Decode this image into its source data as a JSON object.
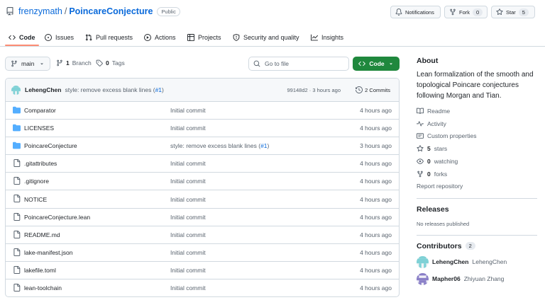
{
  "header": {
    "owner": "frenzymath",
    "separator": "/",
    "repo": "PoincareConjecture",
    "visibility": "Public",
    "notifications_label": "Notifications",
    "fork_label": "Fork",
    "fork_count": "0",
    "star_label": "Star",
    "star_count": "5"
  },
  "tabs": [
    {
      "label": "Code",
      "icon": "code-icon",
      "active": true
    },
    {
      "label": "Issues",
      "icon": "issue-icon"
    },
    {
      "label": "Pull requests",
      "icon": "pull-request-icon"
    },
    {
      "label": "Actions",
      "icon": "play-icon"
    },
    {
      "label": "Projects",
      "icon": "table-icon"
    },
    {
      "label": "Security and quality",
      "icon": "shield-icon"
    },
    {
      "label": "Insights",
      "icon": "graph-icon"
    }
  ],
  "toolbar": {
    "branch": "main",
    "branch_count": "1",
    "branch_label": "Branch",
    "tag_count": "0",
    "tag_label": "Tags",
    "search_placeholder": "Go to file",
    "code_button": "Code"
  },
  "latest_commit": {
    "author": "LehengChen",
    "message": "style: remove excess blank lines (",
    "pr_link": "#1",
    "message_end": ")",
    "hash": "99148d2",
    "meta_sep": "·",
    "age": "3 hours ago",
    "commits_label": "2 Commits"
  },
  "files": [
    {
      "name": "Comparator",
      "type": "folder",
      "message": "Initial commit",
      "age": "4 hours ago"
    },
    {
      "name": "LICENSES",
      "type": "folder",
      "message": "Initial commit",
      "age": "4 hours ago"
    },
    {
      "name": "PoincareConjecture",
      "type": "folder",
      "message": "style: remove excess blank lines (",
      "link": "#1",
      "message_end": ")",
      "age": "3 hours ago"
    },
    {
      "name": ".gitattributes",
      "type": "file",
      "message": "Initial commit",
      "age": "4 hours ago"
    },
    {
      "name": ".gitignore",
      "type": "file",
      "message": "Initial commit",
      "age": "4 hours ago"
    },
    {
      "name": "NOTICE",
      "type": "file",
      "message": "Initial commit",
      "age": "4 hours ago"
    },
    {
      "name": "PoincareConjecture.lean",
      "type": "file",
      "message": "Initial commit",
      "age": "4 hours ago"
    },
    {
      "name": "README.md",
      "type": "file",
      "message": "Initial commit",
      "age": "4 hours ago"
    },
    {
      "name": "lake-manifest.json",
      "type": "file",
      "message": "Initial commit",
      "age": "4 hours ago"
    },
    {
      "name": "lakefile.toml",
      "type": "file",
      "message": "Initial commit",
      "age": "4 hours ago"
    },
    {
      "name": "lean-toolchain",
      "type": "file",
      "message": "Initial commit",
      "age": "4 hours ago"
    }
  ],
  "about": {
    "title": "About",
    "description": "Lean formalization of the smooth and topological Poincare conjectures following Morgan and Tian.",
    "readme": "Readme",
    "activity": "Activity",
    "custom_properties": "Custom properties",
    "stars_count": "5",
    "stars_label": "stars",
    "watching_count": "0",
    "watching_label": "watching",
    "forks_count": "0",
    "forks_label": "forks",
    "report": "Report repository"
  },
  "releases": {
    "title": "Releases",
    "empty": "No releases published"
  },
  "contributors": {
    "title": "Contributors",
    "count": "2",
    "list": [
      {
        "login": "LehengChen",
        "name": "LehengChen"
      },
      {
        "login": "Mapher06",
        "name": "Zhiyuan Zhang"
      }
    ]
  },
  "colors": {
    "link": "#0969da",
    "code_button": "#1f883d",
    "active_tab_underline": "#fd8c73",
    "folder": "#54aeff"
  }
}
